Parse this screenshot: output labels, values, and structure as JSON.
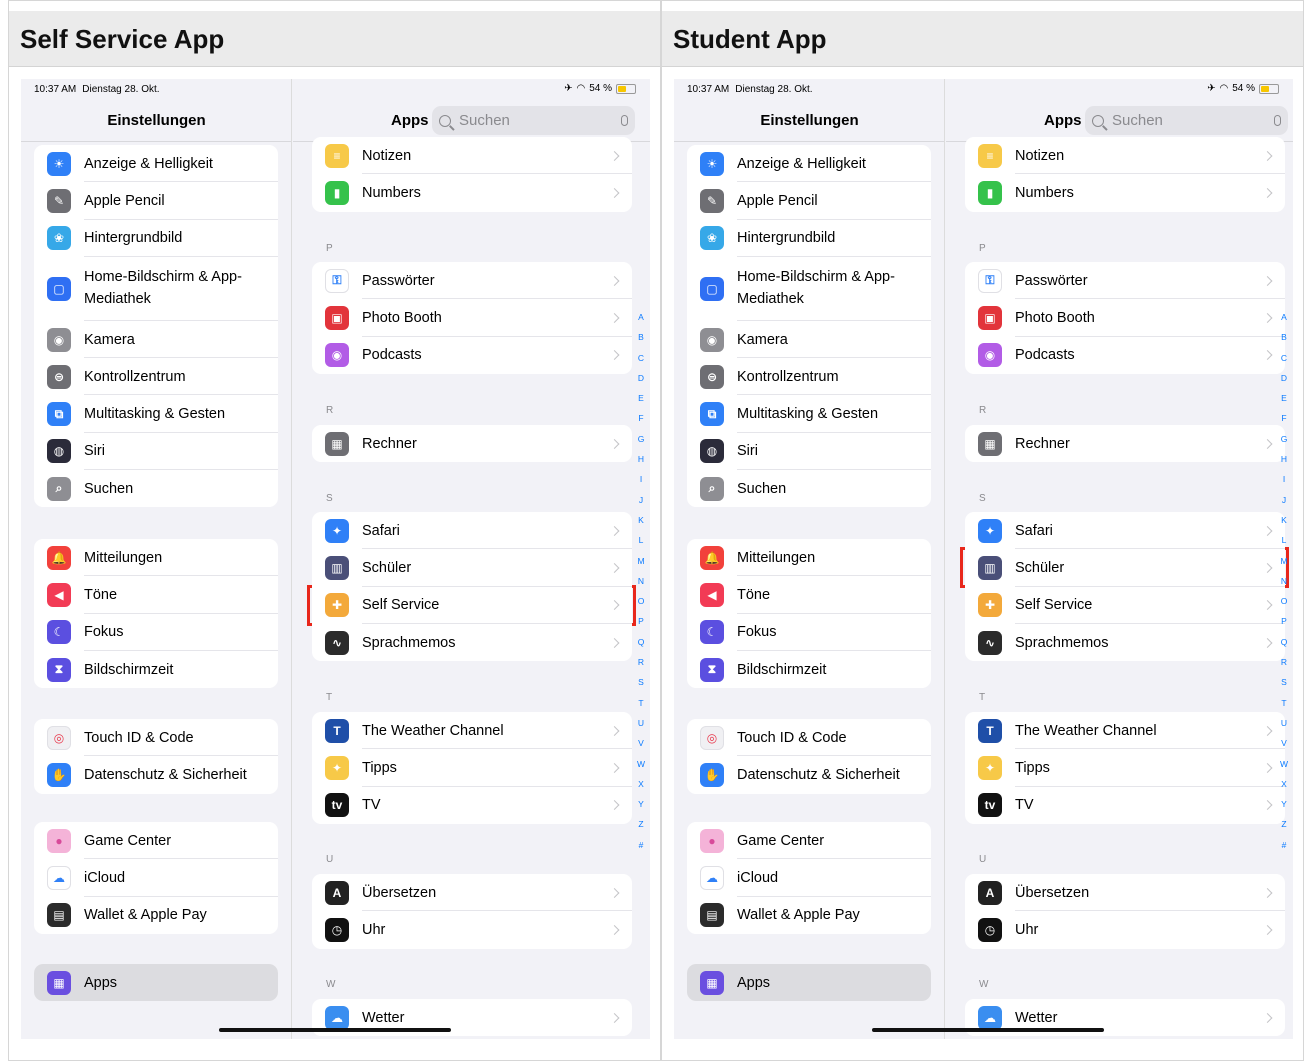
{
  "panels": [
    {
      "title": "Self Service App",
      "time": "10:37 AM",
      "date": "Dienstag 28. Okt.",
      "battery": "54 %",
      "sidebar_title": "Einstellungen",
      "main_title": "Apps",
      "search_placeholder": "Suchen",
      "settings_groups": [
        {
          "items": [
            {
              "label": "Anzeige & Helligkeit",
              "icon": "sun-icon",
              "color": "#2f80f7"
            },
            {
              "label": "Apple Pencil",
              "icon": "pencil-icon",
              "color": "#6e6e73"
            },
            {
              "label": "Hintergrundbild",
              "icon": "flower-icon",
              "color": "#36a8e8"
            },
            {
              "label": "Home-Bildschirm & App-Mediathek",
              "icon": "home-screen-icon",
              "color": "#2f6ff3"
            },
            {
              "label": "Kamera",
              "icon": "camera-icon",
              "color": "#8e8e93"
            },
            {
              "label": "Kontrollzentrum",
              "icon": "switches-icon",
              "color": "#6e6e73"
            },
            {
              "label": "Multitasking & Gesten",
              "icon": "multitasking-icon",
              "color": "#2f80f7"
            },
            {
              "label": "Siri",
              "icon": "siri-icon",
              "color": "#2b2b3a"
            },
            {
              "label": "Suchen",
              "icon": "search-icon",
              "color": "#8e8e93"
            }
          ]
        },
        {
          "items": [
            {
              "label": "Mitteilungen",
              "icon": "bell-icon",
              "color": "#f2413b"
            },
            {
              "label": "Töne",
              "icon": "speaker-icon",
              "color": "#f23b55"
            },
            {
              "label": "Fokus",
              "icon": "moon-icon",
              "color": "#5b4fe0"
            },
            {
              "label": "Bildschirmzeit",
              "icon": "hourglass-icon",
              "color": "#5b4fe0"
            }
          ]
        },
        {
          "items": [
            {
              "label": "Touch ID & Code",
              "icon": "fingerprint-icon",
              "color": "#f0f0f3"
            },
            {
              "label": "Datenschutz & Sicherheit",
              "icon": "hand-icon",
              "color": "#2f80f7"
            }
          ]
        },
        {
          "items": [
            {
              "label": "Game Center",
              "icon": "game-center-icon",
              "color": "#f4b3d8"
            },
            {
              "label": "iCloud",
              "icon": "cloud-icon",
              "color": "#ffffff"
            },
            {
              "label": "Wallet & Apple Pay",
              "icon": "wallet-icon",
              "color": "#2b2b2b"
            }
          ]
        },
        {
          "items": [
            {
              "label": "Apps",
              "icon": "apps-grid-icon",
              "color": "#6a4fe0",
              "selected": true
            }
          ]
        }
      ],
      "app_groups": [
        {
          "section": "",
          "items": [
            {
              "label": "Notizen",
              "icon": "notes-icon",
              "color": "#f7c948"
            },
            {
              "label": "Numbers",
              "icon": "numbers-icon",
              "color": "#35c24b"
            }
          ]
        },
        {
          "section": "P",
          "items": [
            {
              "label": "Passwörter",
              "icon": "key-icon",
              "color": "#ffffff"
            },
            {
              "label": "Photo Booth",
              "icon": "photo-booth-icon",
              "color": "#e2343b"
            },
            {
              "label": "Podcasts",
              "icon": "podcasts-icon",
              "color": "#b25ce6"
            }
          ]
        },
        {
          "section": "R",
          "items": [
            {
              "label": "Rechner",
              "icon": "calculator-icon",
              "color": "#6e6e73"
            }
          ]
        },
        {
          "section": "S",
          "items": [
            {
              "label": "Safari",
              "icon": "compass-icon",
              "color": "#2f80f7"
            },
            {
              "label": "Schüler",
              "icon": "schueler-icon",
              "color": "#4a4f78"
            },
            {
              "label": "Self Service",
              "icon": "self-service-icon",
              "color": "#f3a93b"
            },
            {
              "label": "Sprachmemos",
              "icon": "waveform-icon",
              "color": "#2b2b2b"
            }
          ]
        },
        {
          "section": "T",
          "items": [
            {
              "label": "The Weather Channel",
              "icon": "weather-channel-icon",
              "color": "#1f4fa8"
            },
            {
              "label": "Tipps",
              "icon": "lightbulb-icon",
              "color": "#f7c948"
            },
            {
              "label": "TV",
              "icon": "tv-icon",
              "color": "#111111"
            }
          ]
        },
        {
          "section": "U",
          "items": [
            {
              "label": "Übersetzen",
              "icon": "translate-icon",
              "color": "#222222"
            },
            {
              "label": "Uhr",
              "icon": "clock-icon",
              "color": "#111111"
            }
          ]
        },
        {
          "section": "W",
          "items": [
            {
              "label": "Wetter",
              "icon": "weather-icon",
              "color": "#3a8ef0"
            }
          ]
        }
      ],
      "highlight": "Self Service"
    },
    {
      "title": "Student App",
      "time": "10:37 AM",
      "date": "Dienstag 28. Okt.",
      "battery": "54 %",
      "sidebar_title": "Einstellungen",
      "main_title": "Apps",
      "search_placeholder": "Suchen",
      "settings_groups": "same",
      "app_groups": "same",
      "highlight": "Schüler"
    }
  ],
  "index_letters": [
    "A",
    "B",
    "C",
    "D",
    "E",
    "F",
    "G",
    "H",
    "I",
    "J",
    "K",
    "L",
    "M",
    "N",
    "O",
    "P",
    "Q",
    "R",
    "S",
    "T",
    "U",
    "V",
    "W",
    "X",
    "Y",
    "Z",
    "#"
  ]
}
